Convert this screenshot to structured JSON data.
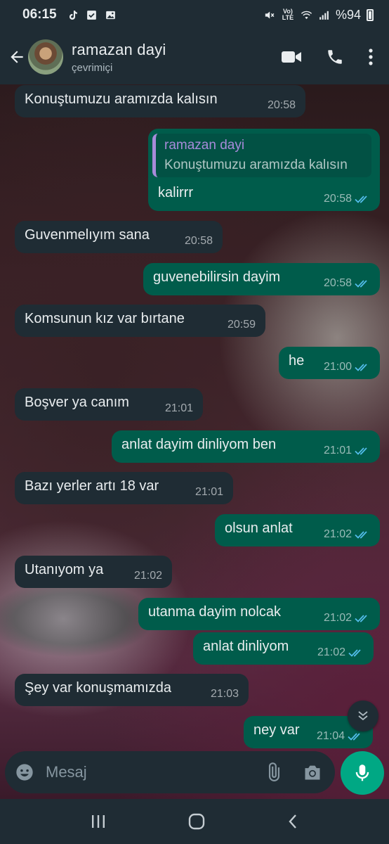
{
  "status_bar": {
    "time": "06:15",
    "battery": "%94",
    "icons": [
      "tiktok-icon",
      "check-square-icon",
      "gallery-icon",
      "mute-icon",
      "volte-icon",
      "wifi-icon",
      "signal-icon",
      "battery-icon"
    ],
    "volte_label": "Vo) LTE"
  },
  "header": {
    "contact_name": "ramazan dayi",
    "contact_status": "çevrimiçi",
    "icons": [
      "back-arrow-icon",
      "video-call-icon",
      "phone-call-icon",
      "more-vert-icon"
    ]
  },
  "chat": {
    "messages": [
      {
        "direction": "in",
        "text": "Konuştumuzu aramızda kalısın",
        "time": "20:58"
      },
      {
        "direction": "out",
        "quote_author": "ramazan dayi",
        "quote_text": "Konuştumuzu aramızda kalısın",
        "text": "kalirrr",
        "time": "20:58",
        "read": true
      },
      {
        "direction": "in",
        "text": "Guvenmelıyım sana",
        "time": "20:58"
      },
      {
        "direction": "out",
        "text": "guvenebilirsin dayim",
        "time": "20:58",
        "read": true
      },
      {
        "direction": "in",
        "text": "Komsunun kız var bırtane",
        "time": "20:59"
      },
      {
        "direction": "out",
        "text": "he",
        "time": "21:00",
        "read": true
      },
      {
        "direction": "in",
        "text": "Boşver ya  canım",
        "time": "21:01"
      },
      {
        "direction": "out",
        "text": "anlat dayim dinliyom ben",
        "time": "21:01",
        "read": true
      },
      {
        "direction": "in",
        "text": "Bazı yerler artı 18 var",
        "time": "21:01"
      },
      {
        "direction": "out",
        "text": "olsun anlat",
        "time": "21:02",
        "read": true
      },
      {
        "direction": "in",
        "text": "Utanıyom ya",
        "time": "21:02"
      },
      {
        "direction": "out",
        "text": "utanma dayim nolcak",
        "time": "21:02",
        "read": true
      },
      {
        "direction": "out",
        "text": "anlat dinliyom",
        "time": "21:02",
        "read": true
      },
      {
        "direction": "in",
        "text": "Şey var konuşmamızda",
        "time": "21:03"
      },
      {
        "direction": "out",
        "text": "ney var",
        "time": "21:04",
        "read": true
      }
    ]
  },
  "input": {
    "placeholder": "Mesaj",
    "icons": [
      "emoji-icon",
      "attach-icon",
      "camera-icon",
      "mic-icon"
    ]
  },
  "colors": {
    "incoming_bubble": "#1f2c34",
    "outgoing_bubble": "#005c4b",
    "read_ticks": "#53bdeb",
    "accent": "#00a884",
    "quote_bar": "#a78bda"
  },
  "nav": {
    "icons": [
      "recent-apps-icon",
      "home-icon",
      "back-nav-icon"
    ]
  }
}
